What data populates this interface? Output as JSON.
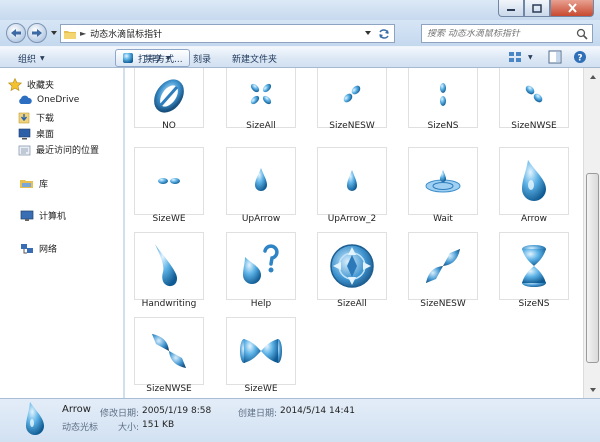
{
  "window": {
    "title_buttons": [
      "minimize-icon",
      "maximize-icon",
      "close-icon"
    ]
  },
  "address": {
    "path": "动态水滴鼠标指针",
    "search_placeholder": "搜索 动态水滴鼠标指针"
  },
  "toolbar": {
    "organize": "组织",
    "open_with": "打开方式...",
    "share": "共享",
    "burn": "刻录",
    "new_folder": "新建文件夹"
  },
  "nav": {
    "favorites": "收藏夹",
    "onedrive": "OneDrive",
    "downloads": "下载",
    "desktop": "桌面",
    "recent": "最近访问的位置",
    "libraries": "库",
    "computer": "计算机",
    "network": "网络"
  },
  "files": [
    {
      "label": "NO",
      "icon": "no-ring-icon"
    },
    {
      "label": "SizeAll",
      "icon": "size-all-small-icon"
    },
    {
      "label": "SizeNESW",
      "icon": "size-nesw-small-icon"
    },
    {
      "label": "SizeNS",
      "icon": "size-ns-small-icon"
    },
    {
      "label": "SizeNWSE",
      "icon": "size-nwse-small-icon"
    },
    {
      "label": "SizeWE",
      "icon": "size-we-small-icon"
    },
    {
      "label": "UpArrow",
      "icon": "uparrow-drop-icon"
    },
    {
      "label": "UpArrow_2",
      "icon": "uparrow2-drop-icon"
    },
    {
      "label": "Wait",
      "icon": "wait-splash-icon"
    },
    {
      "label": "Arrow",
      "icon": "arrow-drop-icon"
    },
    {
      "label": "Handwriting",
      "icon": "handwriting-drop-icon"
    },
    {
      "label": "Help",
      "icon": "help-drop-icon"
    },
    {
      "label": "SizeAll",
      "icon": "size-all-big-icon"
    },
    {
      "label": "SizeNESW",
      "icon": "size-nesw-big-icon"
    },
    {
      "label": "SizeNS",
      "icon": "size-ns-big-icon"
    },
    {
      "label": "SizeNWSE",
      "icon": "size-nwse-big-icon"
    },
    {
      "label": "SizeWE",
      "icon": "size-we-big-icon"
    }
  ],
  "details": {
    "name": "Arrow",
    "type": "动态光标",
    "modified_label": "修改日期:",
    "modified_value": "2005/1/19 8:58",
    "created_label": "创建日期:",
    "created_value": "2014/5/14 14:41",
    "size_label": "大小:",
    "size_value": "151 KB"
  },
  "colors": {
    "drop_light": "#bfe3fb",
    "drop_mid": "#4aa3dc",
    "drop_dark": "#0f5a92",
    "chrome": "#cfdff0"
  }
}
